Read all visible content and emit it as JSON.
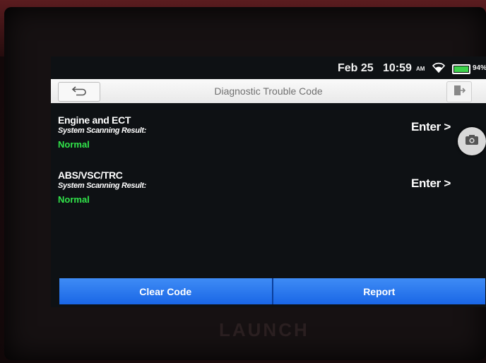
{
  "statusbar": {
    "date": "Feb 25",
    "time": "10:59",
    "ampm": "AM",
    "battery_pct": "94%"
  },
  "titlebar": {
    "title": "Diagnostic Trouble Code"
  },
  "systems": [
    {
      "name": "Engine and ECT",
      "label": "System Scanning Result:",
      "status": "Normal",
      "enter": "Enter >"
    },
    {
      "name": "ABS/VSC/TRC",
      "label": "System Scanning Result:",
      "status": "Normal",
      "enter": "Enter >"
    }
  ],
  "buttons": {
    "clear_code": "Clear Code",
    "report": "Report"
  },
  "brand": "LAUNCH",
  "colors": {
    "status_normal": "#31e44a",
    "button_blue": "#1a66e6",
    "title_bar": "#f0f0f0"
  }
}
